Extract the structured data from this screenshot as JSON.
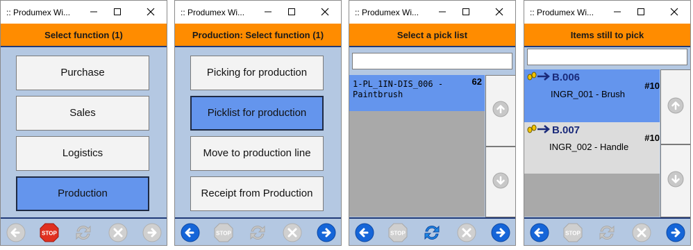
{
  "windows": [
    {
      "title": ":: Produmex Wi...",
      "header": "Select function (1)",
      "buttons": [
        "Purchase",
        "Sales",
        "Logistics",
        "Production"
      ]
    },
    {
      "title": ":: Produmex Wi...",
      "header": "Production: Select function (1)",
      "buttons": [
        "Picking for production",
        "Picklist for production",
        "Move to production line",
        "Receipt from Production"
      ]
    },
    {
      "title": ":: Produmex Wi...",
      "header": "Select a pick list",
      "search_value": "",
      "picklists": [
        {
          "name_line1": "1-PL_1IN-DIS_006 -",
          "name_line2": "Paintbrush",
          "count": "62"
        }
      ]
    },
    {
      "title": ":: Produmex Wi...",
      "header": "Items still to pick",
      "search_value": "",
      "items": [
        {
          "bin": "B.006",
          "item": "INGR_001 - Brush",
          "qty": "#10"
        },
        {
          "bin": "B.007",
          "item": "INGR_002 - Handle",
          "qty": "#10"
        }
      ]
    }
  ],
  "footer": {
    "stop_label": "STOP"
  },
  "colors": {
    "header_orange": "#ff8c00",
    "panel_blue": "#b4c8e2",
    "selected_blue": "#6495ed",
    "nav_blue": "#1565d8",
    "stop_red": "#e03020"
  }
}
